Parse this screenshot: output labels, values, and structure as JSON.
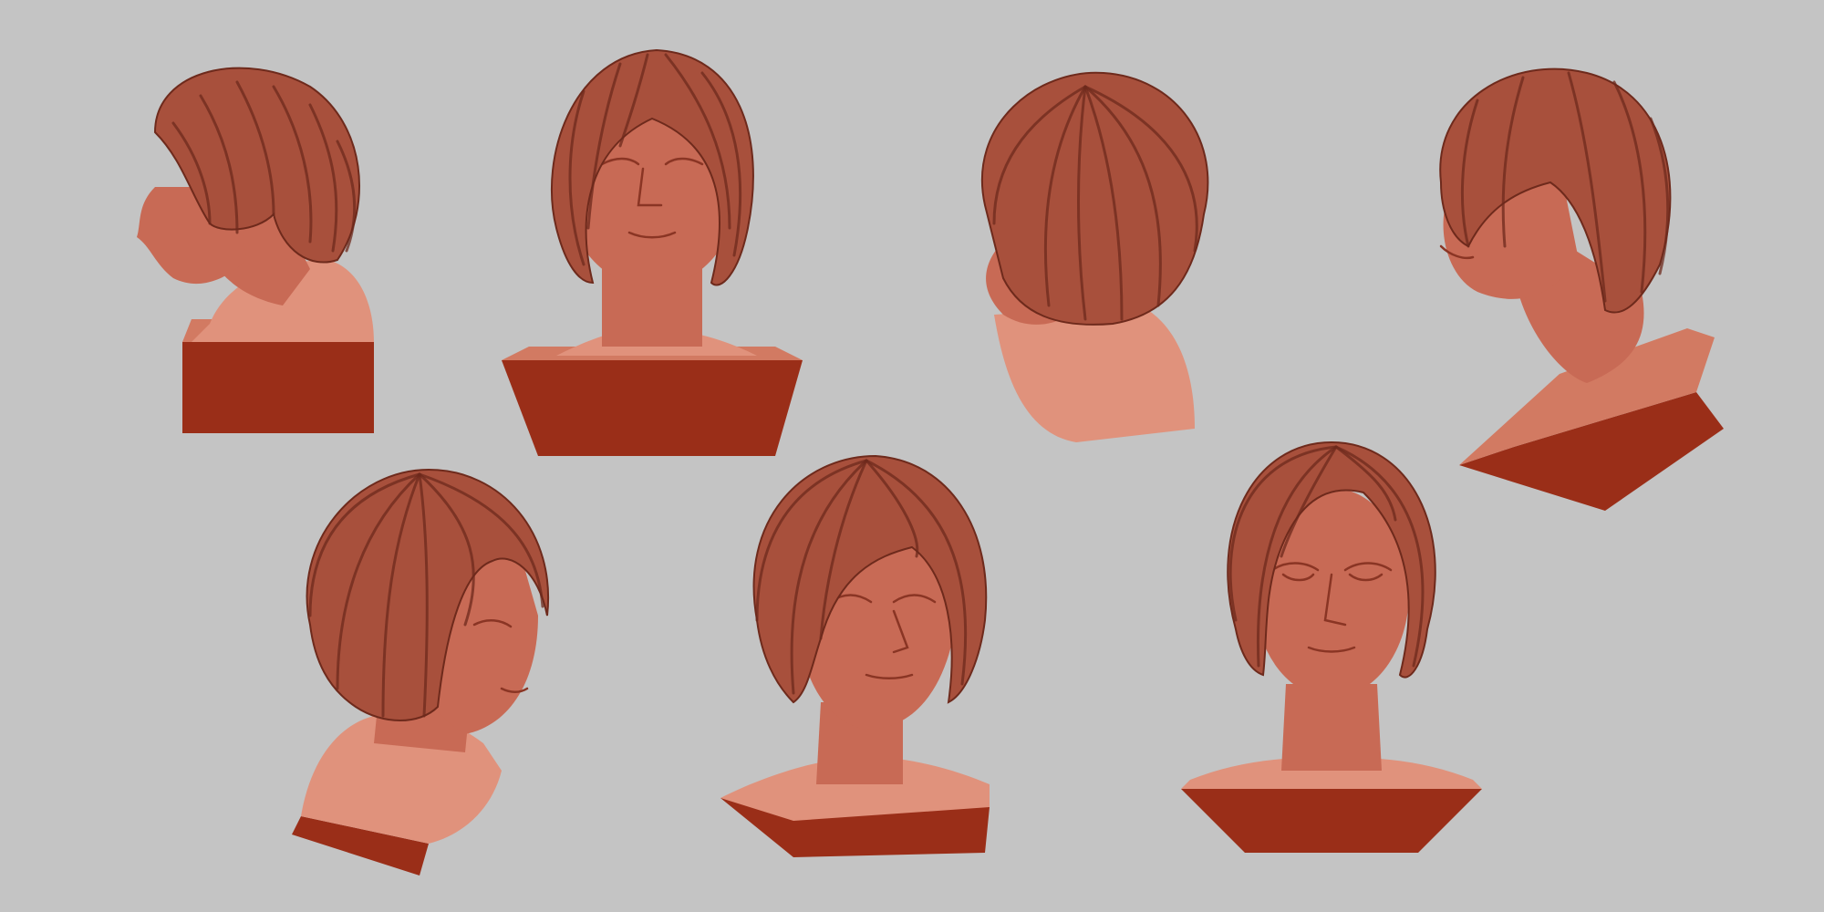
{
  "scene": {
    "background_color": "#c4c4c4",
    "material_colors": {
      "skin": "#c86a55",
      "skin_light": "#e0927c",
      "skin_shadow": "#8a3524",
      "hair": "#a8503c",
      "hair_strand": "#6e2a1c",
      "base_top": "#d27a62",
      "base_side": "#9a2e18"
    },
    "views": [
      {
        "label": "left-profile-view"
      },
      {
        "label": "front-low-angle-view"
      },
      {
        "label": "back-three-quarter-view"
      },
      {
        "label": "left-three-quarter-high-view"
      },
      {
        "label": "right-three-quarter-view"
      },
      {
        "label": "right-front-three-quarter-view"
      },
      {
        "label": "front-view"
      }
    ]
  }
}
